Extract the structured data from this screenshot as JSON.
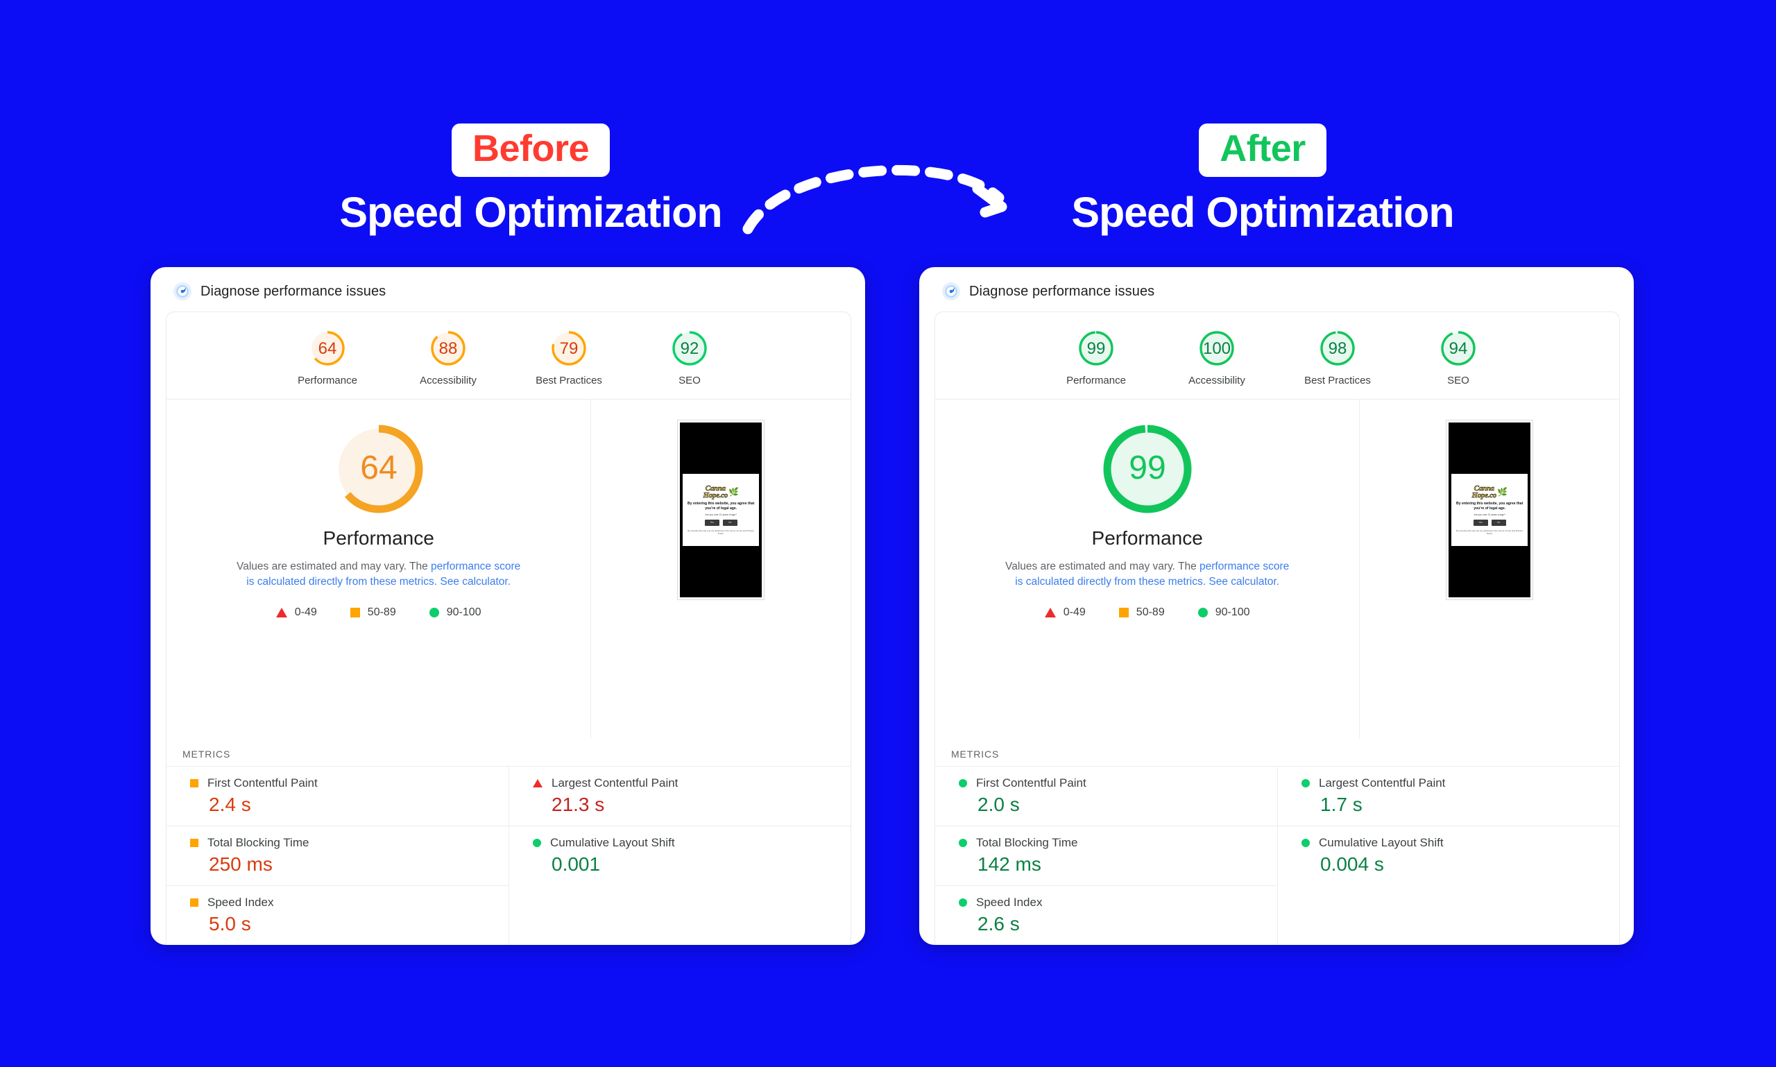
{
  "page": {
    "background_color": "#0D0DF5"
  },
  "headings": {
    "left": {
      "badge": "Before",
      "badge_color": "#FF3B30",
      "title": "Speed Optimization"
    },
    "right": {
      "badge": "After",
      "badge_color": "#12C55B",
      "title": "Speed Optimization"
    }
  },
  "arrow": {
    "name": "curved-dashed-arrow",
    "direction": "left-to-right"
  },
  "colors": {
    "orange": "#FFA400",
    "green": "#0CCE6B",
    "red": "#EE2B2B",
    "link": "#3B7DED",
    "orange_text": "#D93B0B",
    "green_text": "#0B8043"
  },
  "before_card": {
    "header_title": "Diagnose performance issues",
    "header_icon": "diagnose-gauge-icon",
    "categories": [
      {
        "label": "Performance",
        "score": "64",
        "percent": 64,
        "state": "average"
      },
      {
        "label": "Accessibility",
        "score": "88",
        "percent": 88,
        "state": "average"
      },
      {
        "label": "Best Practices",
        "score": "79",
        "percent": 79,
        "state": "average"
      },
      {
        "label": "SEO",
        "score": "92",
        "percent": 92,
        "state": "good"
      }
    ],
    "main_score": {
      "value": "64",
      "percent": 64,
      "label": "Performance",
      "state": "average"
    },
    "disclaimer": {
      "text_1": "Values are estimated and may vary. The ",
      "link_1": "performance score is calculated directly from these metrics.",
      "link_2": "See calculator.",
      "text_2": " "
    },
    "legend": [
      {
        "shape": "triangle",
        "range": "0-49",
        "color": "#EE2B2B"
      },
      {
        "shape": "square",
        "range": "50-89",
        "color": "#FFA400"
      },
      {
        "shape": "circle",
        "range": "90-100",
        "color": "#0CCE6B"
      }
    ],
    "metrics_title": "METRICS",
    "metrics_col1": [
      {
        "name": "First Contentful Paint",
        "value": "2.4 s",
        "shape": "square",
        "state": "average"
      },
      {
        "name": "Total Blocking Time",
        "value": "250 ms",
        "shape": "square",
        "state": "average"
      },
      {
        "name": "Speed Index",
        "value": "5.0 s",
        "shape": "square",
        "state": "average"
      }
    ],
    "metrics_col2": [
      {
        "name": "Largest Contentful Paint",
        "value": "21.3 s",
        "shape": "triangle",
        "state": "poor"
      },
      {
        "name": "Cumulative Layout Shift",
        "value": "0.001",
        "shape": "circle",
        "state": "good"
      }
    ],
    "thumbnail": {
      "name": "page-screenshot-thumbnail",
      "logo_line1": "Canna",
      "logo_line2": "Hope.co",
      "leaf_icon": "cannabis-leaf-icon",
      "headline": "By entering this website, you agree that you're of legal age.",
      "subtext": "Are you over 21 years of age?",
      "button_yes": "Yes",
      "button_no": "No",
      "footer": "By entering this site you are agreeing to the Terms of Use and Privacy Policy."
    }
  },
  "after_card": {
    "header_title": "Diagnose performance issues",
    "header_icon": "diagnose-gauge-icon",
    "categories": [
      {
        "label": "Performance",
        "score": "99",
        "percent": 99,
        "state": "good"
      },
      {
        "label": "Accessibility",
        "score": "100",
        "percent": 100,
        "state": "good"
      },
      {
        "label": "Best Practices",
        "score": "98",
        "percent": 98,
        "state": "good"
      },
      {
        "label": "SEO",
        "score": "94",
        "percent": 94,
        "state": "good"
      }
    ],
    "main_score": {
      "value": "99",
      "percent": 99,
      "label": "Performance",
      "state": "good"
    },
    "disclaimer": {
      "text_1": "Values are estimated and may vary. The ",
      "link_1": "performance score is calculated directly from these metrics.",
      "link_2": "See calculator.",
      "text_2": " "
    },
    "legend": [
      {
        "shape": "triangle",
        "range": "0-49",
        "color": "#EE2B2B"
      },
      {
        "shape": "square",
        "range": "50-89",
        "color": "#FFA400"
      },
      {
        "shape": "circle",
        "range": "90-100",
        "color": "#0CCE6B"
      }
    ],
    "metrics_title": "METRICS",
    "metrics_col1": [
      {
        "name": "First Contentful Paint",
        "value": "2.0 s",
        "shape": "circle",
        "state": "good"
      },
      {
        "name": "Total Blocking Time",
        "value": "142 ms",
        "shape": "circle",
        "state": "good"
      },
      {
        "name": "Speed Index",
        "value": "2.6 s",
        "shape": "circle",
        "state": "good"
      }
    ],
    "metrics_col2": [
      {
        "name": "Largest Contentful Paint",
        "value": "1.7 s",
        "shape": "circle",
        "state": "good"
      },
      {
        "name": "Cumulative Layout Shift",
        "value": "0.004 s",
        "shape": "circle",
        "state": "good"
      }
    ],
    "thumbnail": {
      "name": "page-screenshot-thumbnail",
      "logo_line1": "Canna",
      "logo_line2": "Hope.co",
      "leaf_icon": "cannabis-leaf-icon",
      "headline": "By entering this website, you agree that you're of legal age.",
      "subtext": "Are you over 21 years of age?",
      "button_yes": "Yes",
      "button_no": "No",
      "footer": "By entering this site you are agreeing to the Terms of Use and Privacy Policy."
    }
  }
}
